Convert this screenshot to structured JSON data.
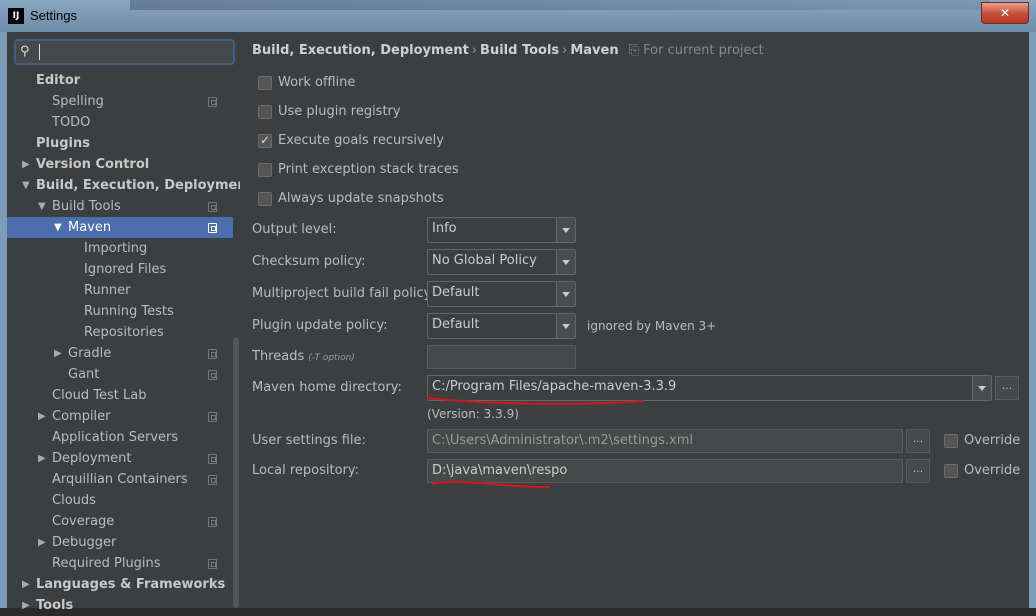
{
  "window": {
    "title": "Settings",
    "app_icon": "IJ",
    "close_glyph": "✕"
  },
  "search": {
    "value": "",
    "icon": "search-icon"
  },
  "tree": [
    {
      "label": "Editor"
    },
    {
      "label": "Spelling"
    },
    {
      "label": "TODO"
    },
    {
      "label": "Plugins"
    },
    {
      "label": "Version Control"
    },
    {
      "label": "Build, Execution, Deployment"
    },
    {
      "label": "Build Tools"
    },
    {
      "label": "Maven",
      "selected": true
    },
    {
      "label": "Importing"
    },
    {
      "label": "Ignored Files"
    },
    {
      "label": "Runner"
    },
    {
      "label": "Running Tests"
    },
    {
      "label": "Repositories"
    },
    {
      "label": "Gradle"
    },
    {
      "label": "Gant"
    },
    {
      "label": "Cloud Test Lab"
    },
    {
      "label": "Compiler"
    },
    {
      "label": "Application Servers"
    },
    {
      "label": "Deployment"
    },
    {
      "label": "Arquillian Containers"
    },
    {
      "label": "Clouds"
    },
    {
      "label": "Coverage"
    },
    {
      "label": "Debugger"
    },
    {
      "label": "Required Plugins"
    },
    {
      "label": "Languages & Frameworks"
    },
    {
      "label": "Tools"
    }
  ],
  "breadcrumb": {
    "items": [
      "Build, Execution, Deployment",
      "Build Tools",
      "Maven"
    ],
    "separator": "›",
    "scope": "For current project"
  },
  "options": [
    {
      "label": "Work offline",
      "checked": false
    },
    {
      "label": "Use plugin registry",
      "checked": false
    },
    {
      "label": "Execute goals recursively",
      "checked": true
    },
    {
      "label": "Print exception stack traces",
      "checked": false
    },
    {
      "label": "Always update snapshots",
      "checked": false
    }
  ],
  "settings": {
    "output_level": {
      "label": "Output level:",
      "value": "Info"
    },
    "checksum_policy": {
      "label": "Checksum policy:",
      "value": "No Global Policy"
    },
    "fail_policy": {
      "label": "Multiproject build fail policy:",
      "value": "Default"
    },
    "plugin_update_policy": {
      "label": "Plugin update policy:",
      "value": "Default",
      "note": "ignored by Maven 3+"
    },
    "threads": {
      "label": "Threads",
      "hint": "(-T option)",
      "value": ""
    },
    "maven_home": {
      "label": "Maven home directory:",
      "value": "C:/Program Files/apache-maven-3.3.9",
      "version": "(Version: 3.3.9)"
    },
    "user_settings": {
      "label": "User settings file:",
      "value": "C:\\Users\\Administrator\\.m2\\settings.xml",
      "override": "Override"
    },
    "local_repo": {
      "label": "Local repository:",
      "value": "D:\\java\\maven\\respo",
      "override": "Override"
    },
    "browse_label": "..."
  },
  "colors": {
    "selection": "#4b6eaf",
    "annotation": "#cc1a1a",
    "close": "#c74a38"
  }
}
